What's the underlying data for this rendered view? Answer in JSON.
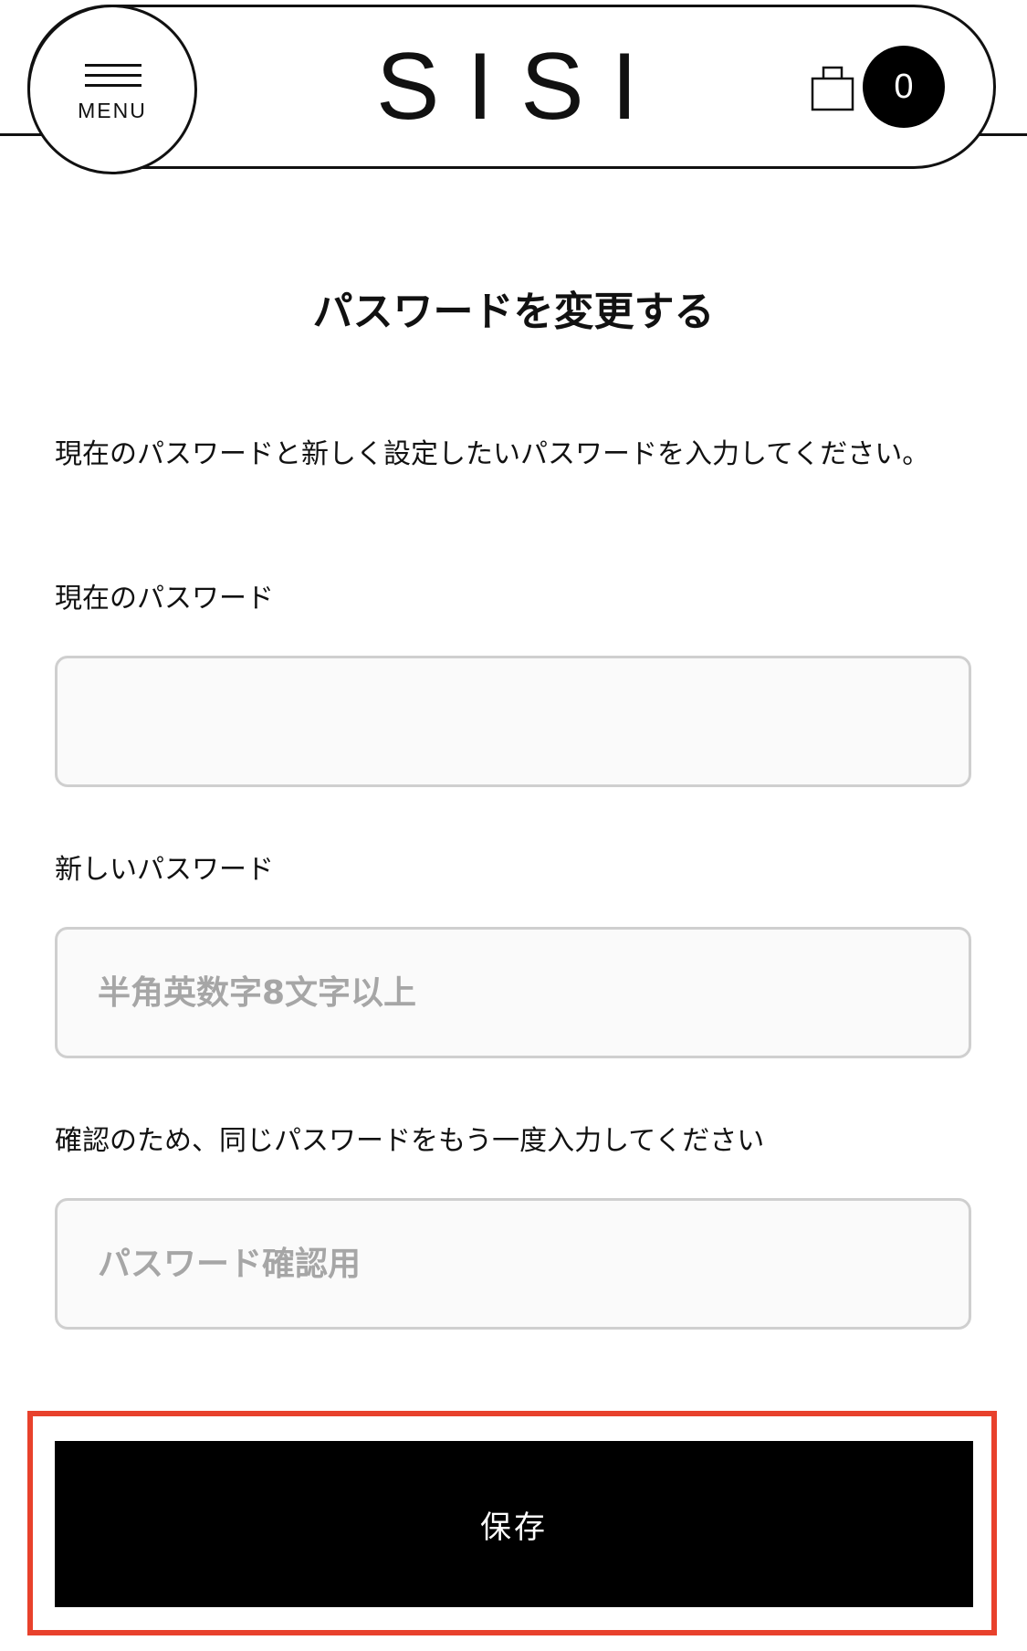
{
  "header": {
    "menu_label": "MENU",
    "logo_text": "SISI",
    "cart_count": "0"
  },
  "page": {
    "title": "パスワードを変更する",
    "intro": "現在のパスワードと新しく設定したいパスワードを入力してください。"
  },
  "form": {
    "current_password": {
      "label": "現在のパスワード",
      "placeholder": "",
      "value": ""
    },
    "new_password": {
      "label": "新しいパスワード",
      "placeholder": "半角英数字8文字以上",
      "value": ""
    },
    "confirm_password": {
      "label": "確認のため、同じパスワードをもう一度入力してください",
      "placeholder": "パスワード確認用",
      "value": ""
    },
    "save_label": "保存"
  },
  "colors": {
    "highlight": "#e8412c",
    "button_bg": "#000000",
    "input_border": "#cfcfcf",
    "placeholder": "#a6a6a6"
  },
  "icons": {
    "menu": "menu-icon",
    "cart": "shopping-bag-icon"
  }
}
